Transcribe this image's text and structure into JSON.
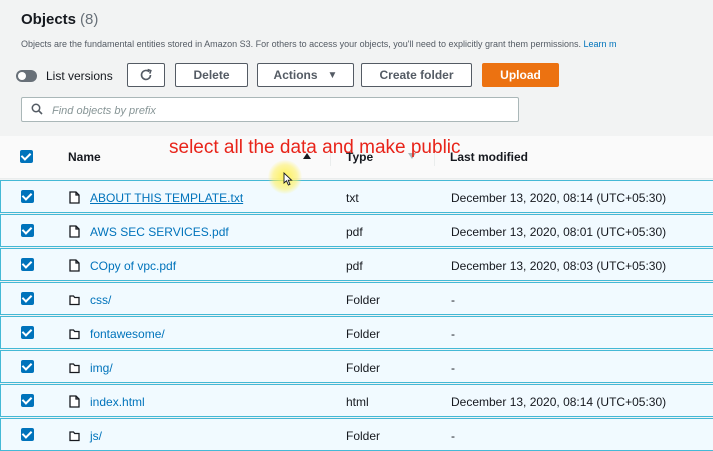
{
  "header": {
    "title": "Objects",
    "count": "(8)",
    "description": "Objects are the fundamental entities stored in Amazon S3. For others to access your objects, you'll need to explicitly grant them permissions.",
    "learn_more": "Learn m"
  },
  "toolbar": {
    "toggle_label": "List versions",
    "refresh_icon": "refresh-icon",
    "delete_label": "Delete",
    "actions_label": "Actions",
    "create_folder_label": "Create folder",
    "upload_label": "Upload"
  },
  "search": {
    "placeholder": "Find objects by prefix"
  },
  "table": {
    "columns": {
      "name": "Name",
      "type": "Type",
      "last_modified": "Last modified"
    },
    "rows": [
      {
        "name": "ABOUT THIS TEMPLATE.txt",
        "type": "txt",
        "last_modified": "December 13, 2020, 08:14 (UTC+05:30)",
        "icon": "file-icon",
        "selected": true
      },
      {
        "name": "AWS SEC SERVICES.pdf",
        "type": "pdf",
        "last_modified": "December 13, 2020, 08:01 (UTC+05:30)",
        "icon": "file-icon",
        "selected": true
      },
      {
        "name": "COpy of vpc.pdf",
        "type": "pdf",
        "last_modified": "December 13, 2020, 08:03 (UTC+05:30)",
        "icon": "file-icon",
        "selected": true
      },
      {
        "name": "css/",
        "type": "Folder",
        "last_modified": "-",
        "icon": "folder-icon",
        "selected": true
      },
      {
        "name": "fontawesome/",
        "type": "Folder",
        "last_modified": "-",
        "icon": "folder-icon",
        "selected": true
      },
      {
        "name": "img/",
        "type": "Folder",
        "last_modified": "-",
        "icon": "folder-icon",
        "selected": true
      },
      {
        "name": "index.html",
        "type": "html",
        "last_modified": "December 13, 2020, 08:14 (UTC+05:30)",
        "icon": "file-icon",
        "selected": true
      },
      {
        "name": "js/",
        "type": "Folder",
        "last_modified": "-",
        "icon": "folder-icon",
        "selected": true
      }
    ]
  },
  "annotation": "select all the data and make public",
  "colors": {
    "accent": "#0073bb",
    "upload": "#ec7211",
    "annotation": "#e8241a",
    "row_selected": "#f1faff"
  }
}
